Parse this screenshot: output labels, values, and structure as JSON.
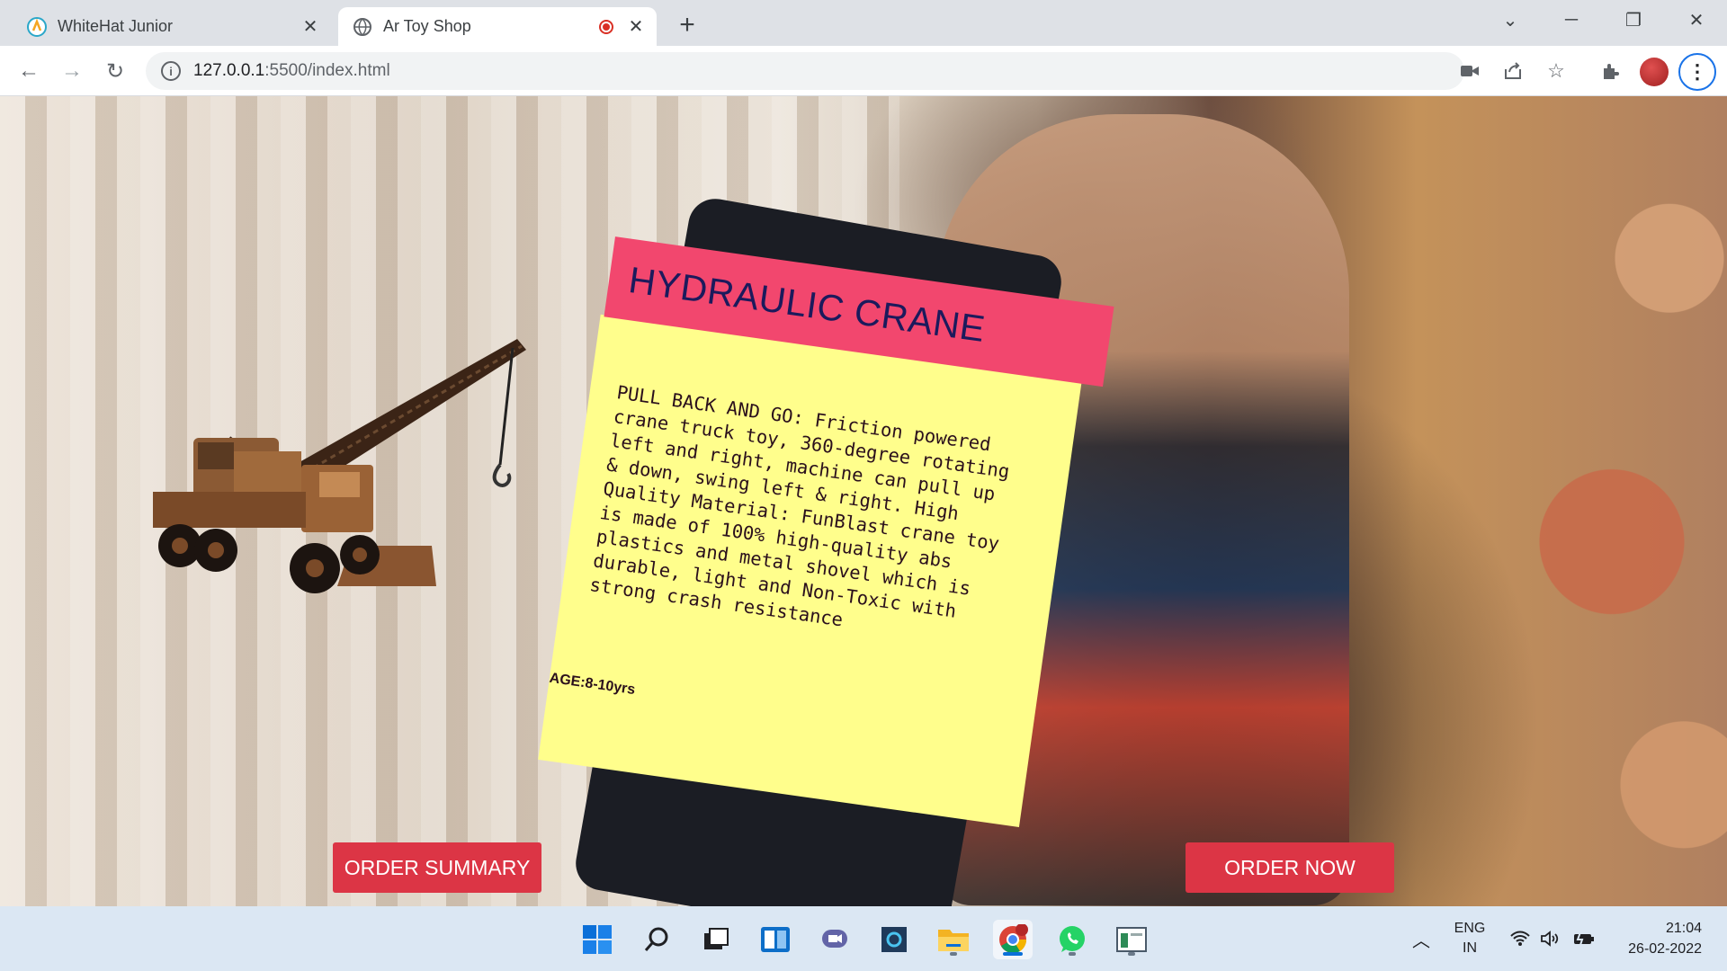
{
  "browser": {
    "tabs": [
      {
        "title": "WhiteHat Junior",
        "icon": "whitehat-icon",
        "active": false
      },
      {
        "title": "Ar Toy Shop",
        "icon": "globe-icon",
        "active": true,
        "recording": true
      }
    ],
    "address": {
      "host": "127.0.0.1",
      "rest": ":5500/index.html"
    }
  },
  "product": {
    "title": "HYDRAULIC CRANE",
    "description": "PULL BACK AND GO: Friction powered\ncrane truck toy, 360-degree rotating\nleft and right, machine can pull up\n& down, swing left & right. High\nQuality Material: FunBlast crane toy\nis made of 100% high-quality abs\nplastics and metal shovel which is\ndurable, light and Non-Toxic with\nstrong crash resistance",
    "age": "AGE:8-10yrs",
    "colors": {
      "header": "#f2476e",
      "card": "#fffe8c",
      "title_text": "#1c1a5c"
    }
  },
  "buttons": {
    "order_summary": "ORDER SUMMARY",
    "order_now": "ORDER NOW",
    "color": "#dc3545"
  },
  "taskbar": {
    "language": {
      "top": "ENG",
      "bottom": "IN"
    },
    "time": "21:04",
    "date": "26-02-2022"
  }
}
